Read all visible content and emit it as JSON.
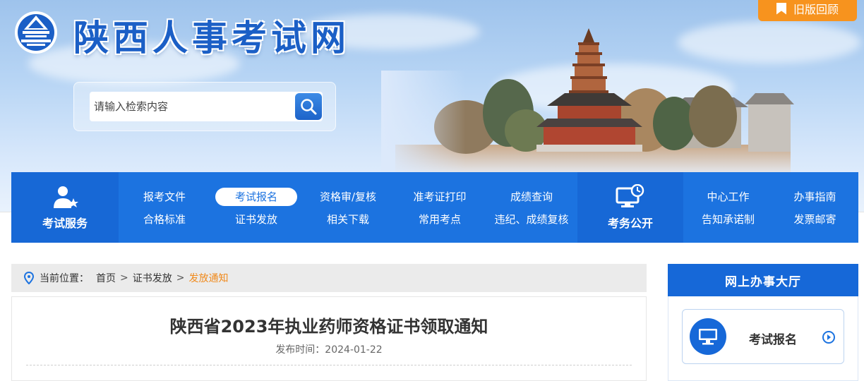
{
  "header": {
    "site_title": "陕西人事考试网",
    "old_version_label": "旧版回顾"
  },
  "search": {
    "placeholder": "请输入检索内容"
  },
  "nav": {
    "service_label": "考试服务",
    "row1": [
      "报考文件",
      "考试报名",
      "资格审/复核",
      "准考证打印",
      "成绩查询"
    ],
    "row2": [
      "合格标准",
      "证书发放",
      "相关下载",
      "常用考点",
      "违纪、成绩复核"
    ],
    "active_item": "考试报名",
    "public_label": "考务公开",
    "right_row1": [
      "中心工作",
      "办事指南"
    ],
    "right_row2": [
      "告知承诺制",
      "发票邮寄"
    ]
  },
  "breadcrumb": {
    "prefix": "当前位置：",
    "items": [
      "首页",
      "证书发放",
      "发放通知"
    ],
    "separator": ">"
  },
  "article": {
    "title": "陕西省2023年执业药师资格证书领取通知",
    "date_label": "发布时间：2024-01-22"
  },
  "sidebar": {
    "title": "网上办事大厅",
    "card_label": "考试报名"
  },
  "colors": {
    "primary_blue": "#1c73e0",
    "accent_orange": "#f7931e",
    "breadcrumb_current": "#f08a1c"
  }
}
